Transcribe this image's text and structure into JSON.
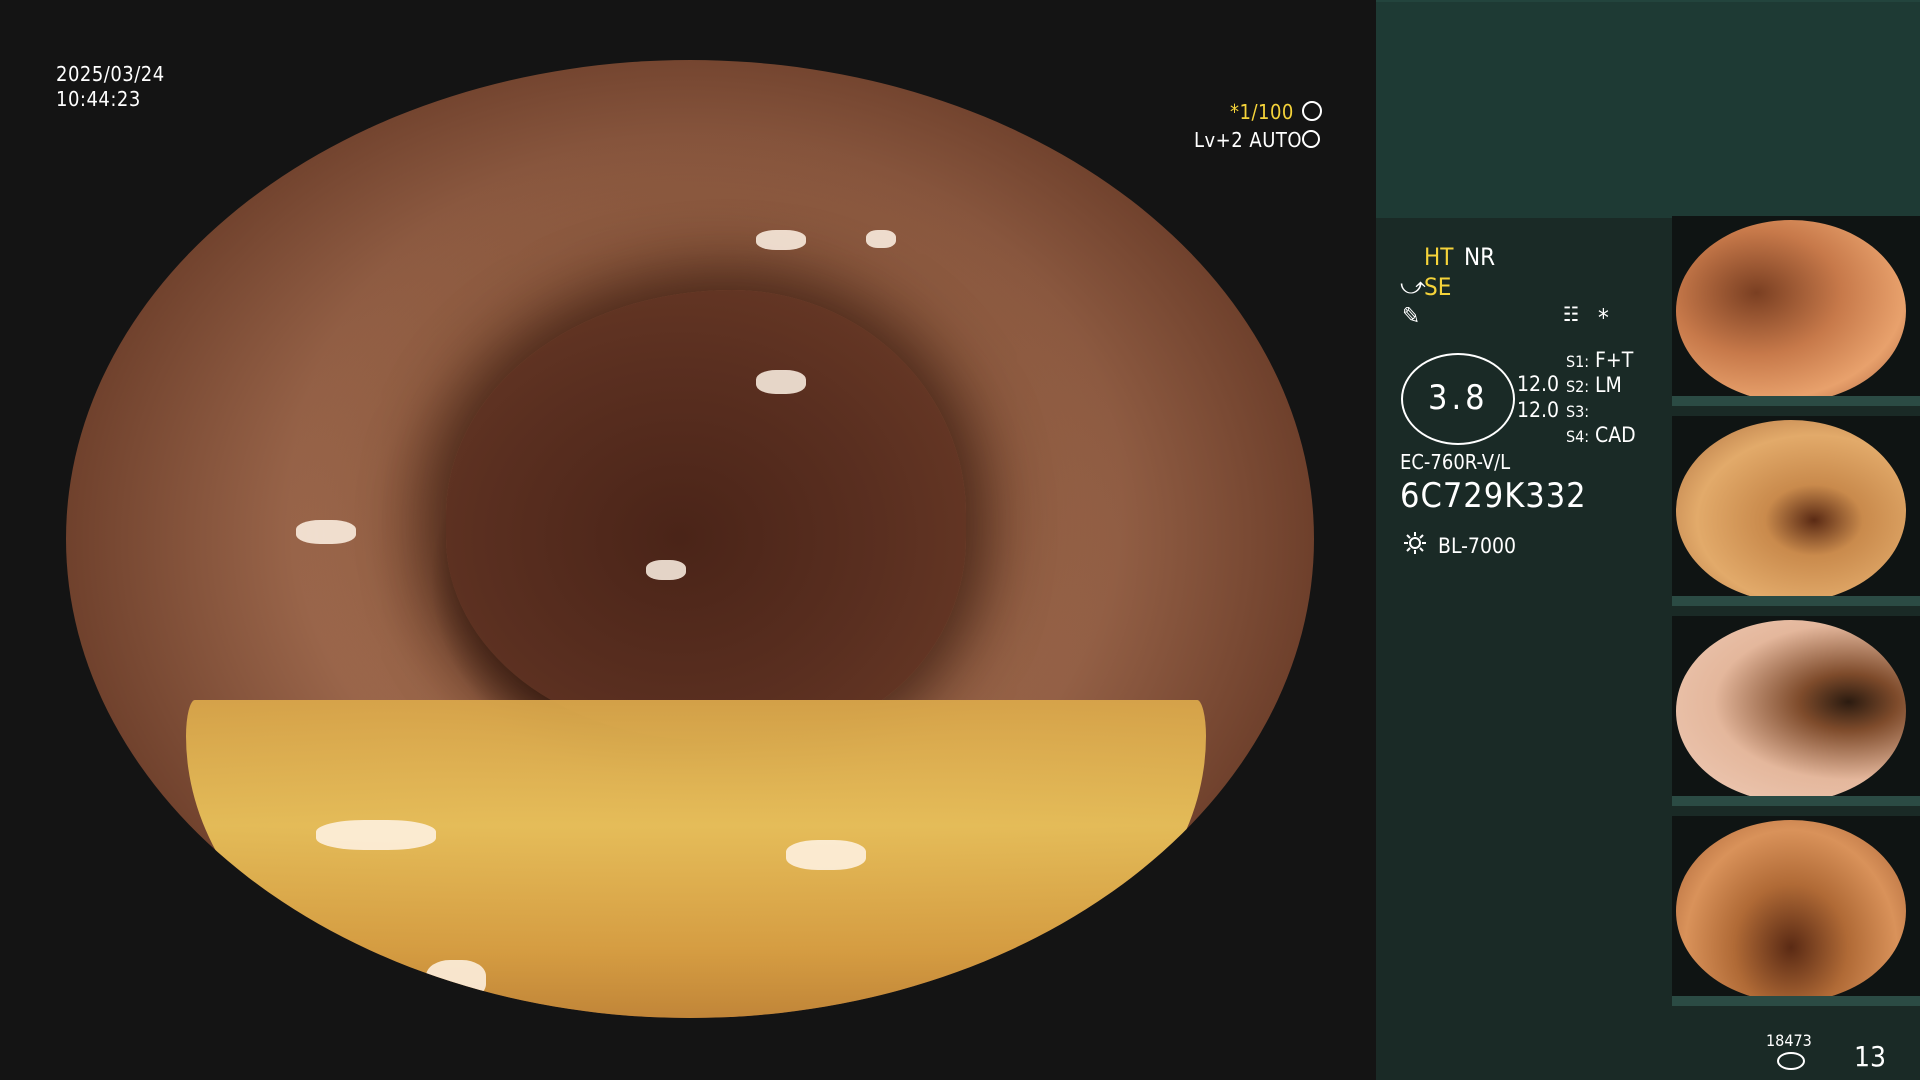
{
  "main": {
    "date": "2025/03/24",
    "time": "10:44:23",
    "exposure_label": "*1/100",
    "level_label": "Lv+2 AUTO"
  },
  "side": {
    "mode_ht": "HT",
    "mode_nr": "NR",
    "mode_se": "SE",
    "speed_value": "3.8",
    "value_top": "12.0",
    "value_bottom": "12.0",
    "s1_label": "S1:",
    "s1_value": "F+T",
    "s2_label": "S2:",
    "s2_value": "LM",
    "s3_label": "S3:",
    "s3_value": "",
    "s4_label": "S4:",
    "s4_value": "CAD",
    "scope_model": "EC-760R-V/L",
    "serial": "6C729K332",
    "lamp": "BL-7000",
    "asterisk": "*",
    "storage_count": "18473",
    "page_number": "13"
  },
  "icons": {
    "exposure": "aperture-icon",
    "auto": "target-icon",
    "edit": "pencil-icon",
    "lamp": "sun-icon",
    "storage": "disk-icon",
    "settings": "list-settings-icon"
  }
}
